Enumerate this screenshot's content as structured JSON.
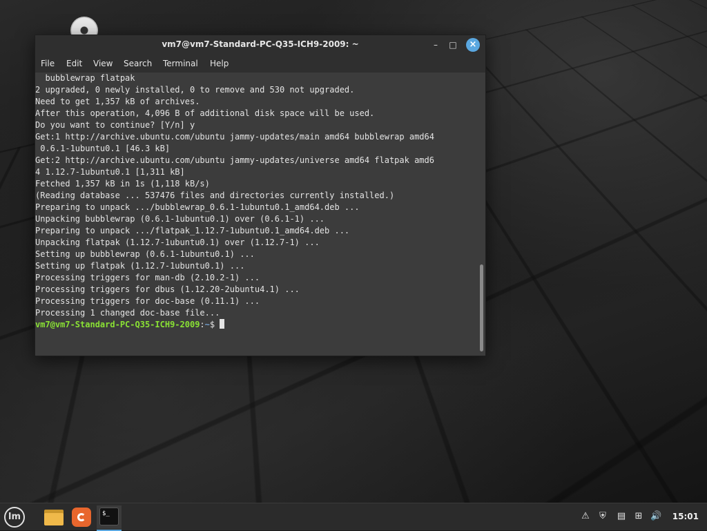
{
  "window": {
    "title": "vm7@vm7-Standard-PC-Q35-ICH9-2009: ~",
    "minimize_glyph": "–",
    "maximize_glyph": "□",
    "close_glyph": "×"
  },
  "menu": [
    "File",
    "Edit",
    "View",
    "Search",
    "Terminal",
    "Help"
  ],
  "terminal": {
    "lines": [
      "  bubblewrap flatpak",
      "2 upgraded, 0 newly installed, 0 to remove and 530 not upgraded.",
      "Need to get 1,357 kB of archives.",
      "After this operation, 4,096 B of additional disk space will be used.",
      "Do you want to continue? [Y/n] y",
      "Get:1 http://archive.ubuntu.com/ubuntu jammy-updates/main amd64 bubblewrap amd64",
      " 0.6.1-1ubuntu0.1 [46.3 kB]",
      "Get:2 http://archive.ubuntu.com/ubuntu jammy-updates/universe amd64 flatpak amd6",
      "4 1.12.7-1ubuntu0.1 [1,311 kB]",
      "Fetched 1,357 kB in 1s (1,118 kB/s)",
      "(Reading database ... 537476 files and directories currently installed.)",
      "Preparing to unpack .../bubblewrap_0.6.1-1ubuntu0.1_amd64.deb ...",
      "Unpacking bubblewrap (0.6.1-1ubuntu0.1) over (0.6.1-1) ...",
      "Preparing to unpack .../flatpak_1.12.7-1ubuntu0.1_amd64.deb ...",
      "Unpacking flatpak (1.12.7-1ubuntu0.1) over (1.12.7-1) ...",
      "Setting up bubblewrap (0.6.1-1ubuntu0.1) ...",
      "Setting up flatpak (1.12.7-1ubuntu0.1) ...",
      "Processing triggers for man-db (2.10.2-1) ...",
      "Processing triggers for dbus (1.12.20-2ubuntu4.1) ...",
      "Processing triggers for doc-base (0.11.1) ...",
      "Processing 1 changed doc-base file..."
    ],
    "prompt_user": "vm7@vm7-Standard-PC-Q35-ICH9-2009",
    "prompt_sep": ":",
    "prompt_path": "~",
    "prompt_symbol": "$ "
  },
  "taskbar": {
    "menu_glyph": "lm",
    "terminal_glyph": "$_",
    "clock": "15:01",
    "tray": [
      {
        "name": "update-manager-icon",
        "glyph": "⚠"
      },
      {
        "name": "shield-icon",
        "glyph": "⛨"
      },
      {
        "name": "clipboard-icon",
        "glyph": "▤"
      },
      {
        "name": "network-icon",
        "glyph": "⊞"
      },
      {
        "name": "volume-icon",
        "glyph": "🔊"
      }
    ]
  },
  "colors": {
    "prompt_user": "#8ae234",
    "prompt_path": "#729fcf",
    "close_button": "#5aa7e0",
    "terminal_bg": "#3c3c3c"
  }
}
